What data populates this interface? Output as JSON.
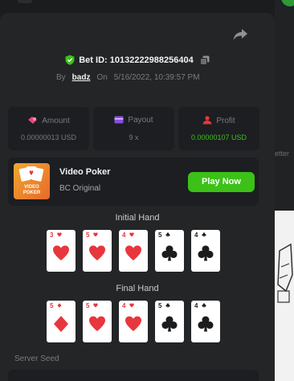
{
  "bet": {
    "id_label": "Bet ID: 10132222988256404",
    "by_label": "By",
    "user": "badz",
    "on_label": "On",
    "datetime": "5/16/2022, 10:39:57 PM"
  },
  "stats": [
    {
      "label": "Amount",
      "value": "0.00000013 USD",
      "icon": "amount-icon",
      "color": "#e8467a"
    },
    {
      "label": "Payout",
      "value": "9 x",
      "icon": "payout-icon",
      "color": "#8b4be8"
    },
    {
      "label": "Profit",
      "value": "0.00000107 USD",
      "icon": "profit-icon",
      "color": "#e8363d"
    }
  ],
  "game": {
    "name": "Video Poker",
    "provider": "BC Original",
    "thumb_text_1": "VIDEO",
    "thumb_text_2": "POKER",
    "play_label": "Play Now"
  },
  "hands": {
    "initial_title": "Initial Hand",
    "final_title": "Final Hand",
    "initial": [
      {
        "rank": "3",
        "suit": "heart"
      },
      {
        "rank": "5",
        "suit": "heart"
      },
      {
        "rank": "4",
        "suit": "heart"
      },
      {
        "rank": "5",
        "suit": "club"
      },
      {
        "rank": "4",
        "suit": "club"
      }
    ],
    "final": [
      {
        "rank": "5",
        "suit": "diamond"
      },
      {
        "rank": "5",
        "suit": "heart"
      },
      {
        "rank": "4",
        "suit": "heart"
      },
      {
        "rank": "5",
        "suit": "club"
      },
      {
        "rank": "4",
        "suit": "club"
      }
    ]
  },
  "server_seed_label": "Server Seed",
  "background": {
    "partial_text": "etter"
  },
  "colors": {
    "accent_green": "#3bc117",
    "panel": "#232527",
    "card_bg": "#1c1e21"
  }
}
